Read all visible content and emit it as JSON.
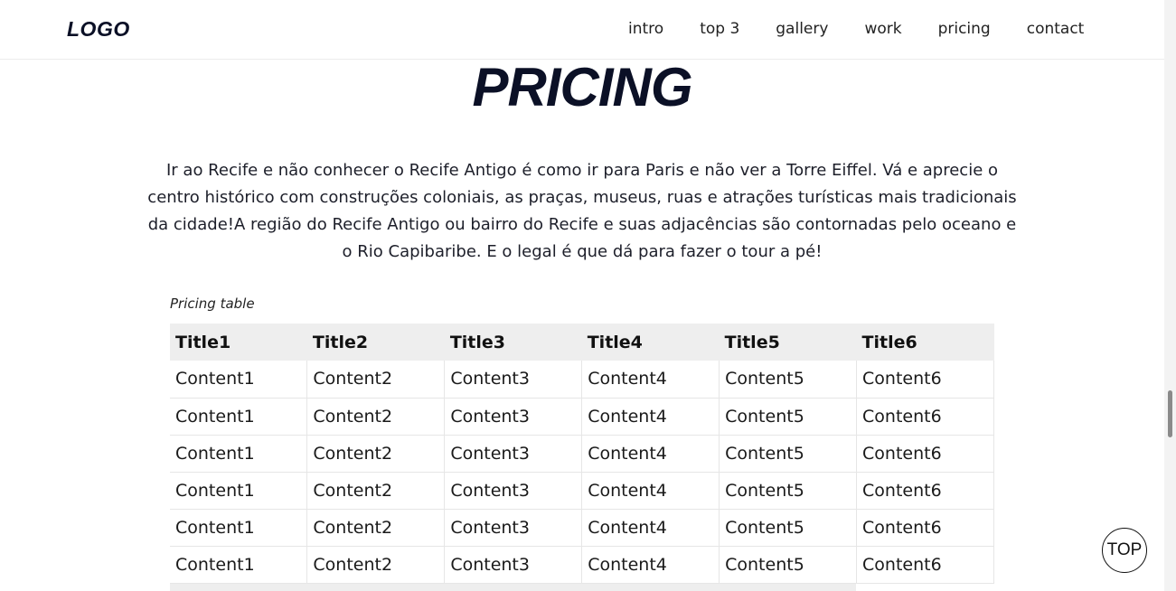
{
  "header": {
    "logo": "LOGO",
    "nav": [
      "intro",
      "top 3",
      "gallery",
      "work",
      "pricing",
      "contact"
    ]
  },
  "section": {
    "title": "PRICING",
    "intro": "Ir ao Recife e não conhecer o Recife Antigo é como ir para Paris e não ver a Torre Eiffel. Vá e aprecie o centro histórico com construções coloniais, as praças, museus, ruas e atrações turísticas mais tradicionais da cidade!A região do Recife Antigo ou bairro do Recife e suas adjacências são contornadas pelo oceano e o Rio Capibaribe. E o legal é que dá para fazer o tour a pé!"
  },
  "table": {
    "caption": "Pricing table",
    "headers": [
      "Title1",
      "Title2",
      "Title3",
      "Title4",
      "Title5",
      "Title6"
    ],
    "rows": [
      [
        "Content1",
        "Content2",
        "Content3",
        "Content4",
        "Content5",
        "Content6"
      ],
      [
        "Content1",
        "Content2",
        "Content3",
        "Content4",
        "Content5",
        "Content6"
      ],
      [
        "Content1",
        "Content2",
        "Content3",
        "Content4",
        "Content5",
        "Content6"
      ],
      [
        "Content1",
        "Content2",
        "Content3",
        "Content4",
        "Content5",
        "Content6"
      ],
      [
        "Content1",
        "Content2",
        "Content3",
        "Content4",
        "Content5",
        "Content6"
      ],
      [
        "Content1",
        "Content2",
        "Content3",
        "Content4",
        "Content5",
        "Content6"
      ]
    ]
  },
  "top_button": {
    "label": "TOP"
  }
}
